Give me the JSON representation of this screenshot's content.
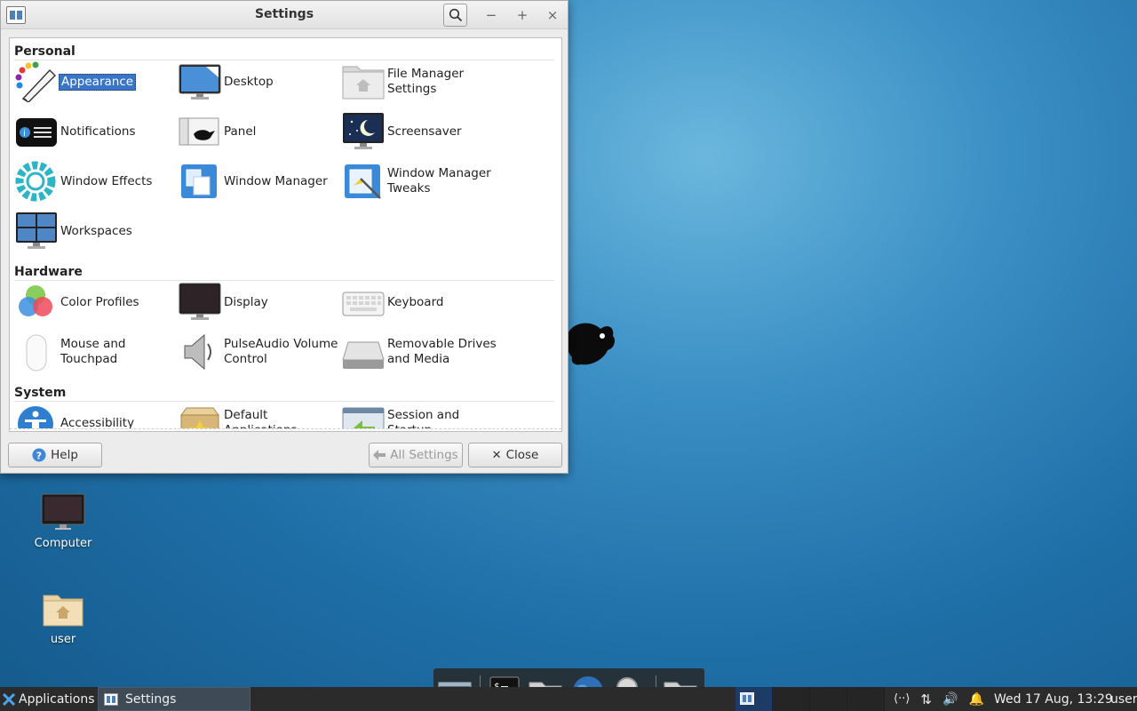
{
  "window": {
    "title": "Settings",
    "controls": {
      "minimize": "−",
      "maximize": "+",
      "close": "×"
    }
  },
  "sections": {
    "personal": {
      "title": "Personal",
      "items": [
        {
          "label": "Appearance",
          "icon": "appearance-icon",
          "selected": true
        },
        {
          "label": "Desktop",
          "icon": "desktop-icon"
        },
        {
          "label": "File Manager\nSettings",
          "icon": "file-manager-icon"
        },
        {
          "label": "Notifications",
          "icon": "notifications-icon"
        },
        {
          "label": "Panel",
          "icon": "panel-icon"
        },
        {
          "label": "Screensaver",
          "icon": "screensaver-icon"
        },
        {
          "label": "Window Effects",
          "icon": "window-effects-icon"
        },
        {
          "label": "Window Manager",
          "icon": "window-manager-icon"
        },
        {
          "label": "Window Manager\nTweaks",
          "icon": "window-manager-tweaks-icon"
        },
        {
          "label": "Workspaces",
          "icon": "workspaces-icon"
        }
      ]
    },
    "hardware": {
      "title": "Hardware",
      "items": [
        {
          "label": "Color Profiles",
          "icon": "color-profiles-icon"
        },
        {
          "label": "Display",
          "icon": "display-icon"
        },
        {
          "label": "Keyboard",
          "icon": "keyboard-icon"
        },
        {
          "label": "Mouse and\nTouchpad",
          "icon": "mouse-icon"
        },
        {
          "label": "PulseAudio Volume\nControl",
          "icon": "speaker-icon"
        },
        {
          "label": "Removable Drives\nand Media",
          "icon": "removable-drive-icon"
        }
      ]
    },
    "system": {
      "title": "System",
      "items": [
        {
          "label": "Accessibility",
          "icon": "accessibility-icon"
        },
        {
          "label": "Default\nApplications",
          "icon": "default-applications-icon"
        },
        {
          "label": "Session and\nStartup",
          "icon": "session-startup-icon"
        }
      ]
    }
  },
  "buttons": {
    "help": "Help",
    "all_settings": "All Settings",
    "close": "Close"
  },
  "desktop": {
    "computer": "Computer",
    "home": "user"
  },
  "taskbar": {
    "applications": "Applications",
    "task": "Settings",
    "clock": "Wed 17 Aug, 13:29",
    "user": "user"
  },
  "colors": {
    "selection": "#3874c8",
    "taskbar": "#2b2b2b",
    "desktop": "#1f6fa8"
  }
}
